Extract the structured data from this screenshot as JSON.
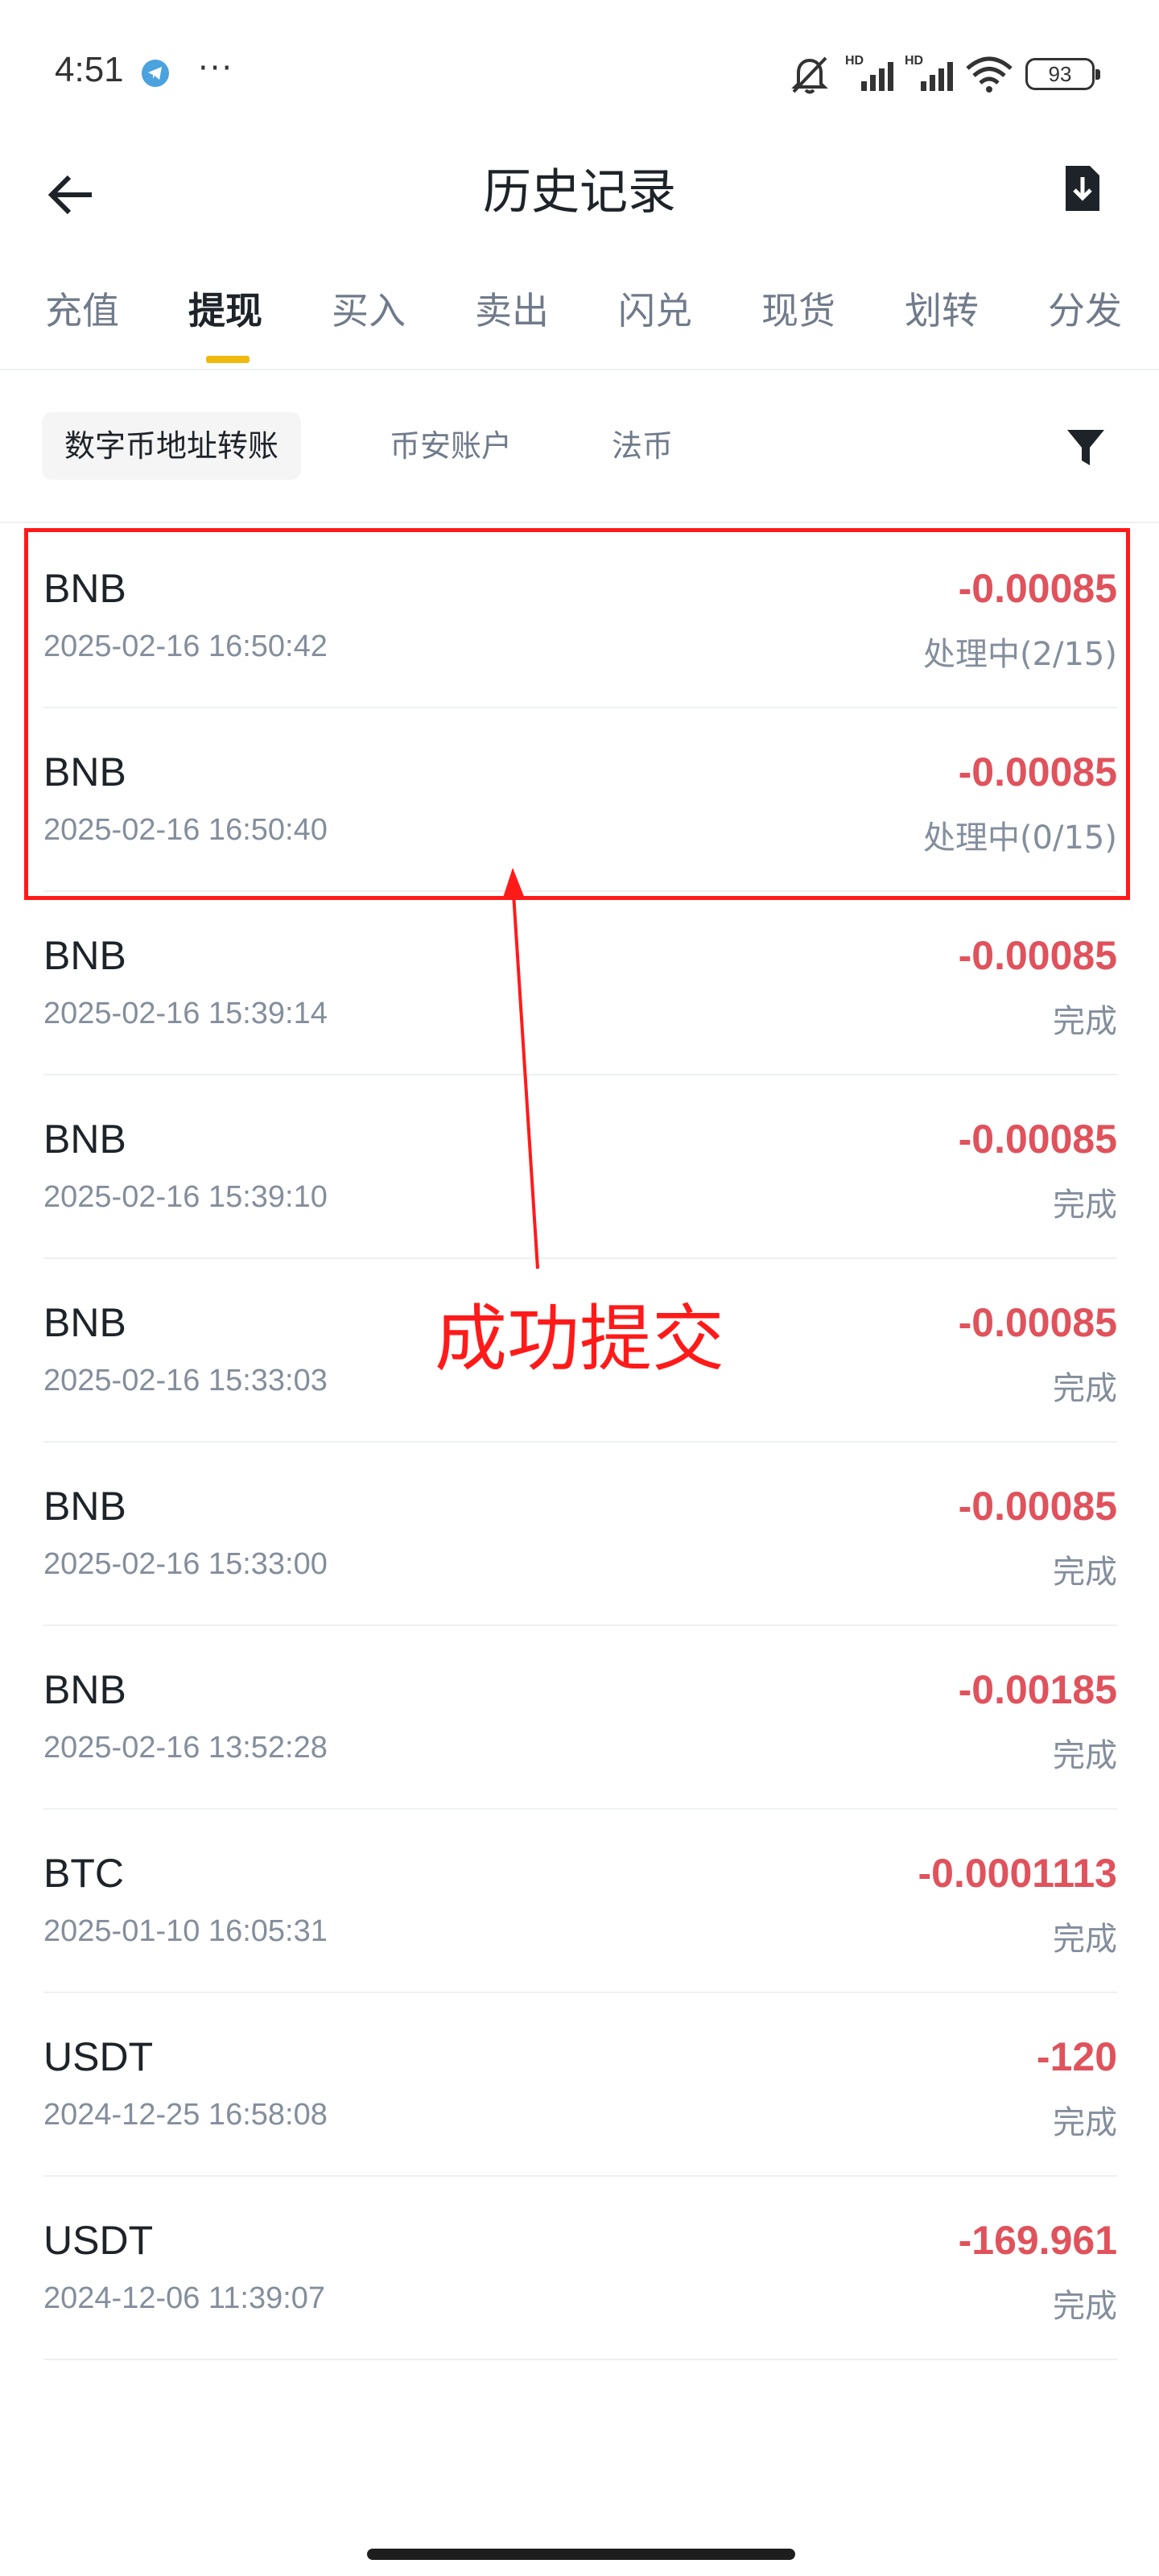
{
  "status_bar": {
    "time": "4:51",
    "more": "···",
    "hd1": "HD",
    "hd2": "HD",
    "battery": "93"
  },
  "header": {
    "title": "历史记录"
  },
  "tabs": [
    {
      "label": "充值"
    },
    {
      "label": "提现",
      "active": true
    },
    {
      "label": "买入"
    },
    {
      "label": "卖出"
    },
    {
      "label": "闪兑"
    },
    {
      "label": "现货"
    },
    {
      "label": "划转"
    },
    {
      "label": "分发"
    }
  ],
  "filters": [
    {
      "label": "数字币地址转账",
      "active": true
    },
    {
      "label": "币安账户"
    },
    {
      "label": "法币"
    }
  ],
  "records": [
    {
      "coin": "BNB",
      "time": "2025-02-16 16:50:42",
      "amount": "-0.00085",
      "status": "处理中(2/15)"
    },
    {
      "coin": "BNB",
      "time": "2025-02-16 16:50:40",
      "amount": "-0.00085",
      "status": "处理中(0/15)"
    },
    {
      "coin": "BNB",
      "time": "2025-02-16 15:39:14",
      "amount": "-0.00085",
      "status": "完成"
    },
    {
      "coin": "BNB",
      "time": "2025-02-16 15:39:10",
      "amount": "-0.00085",
      "status": "完成"
    },
    {
      "coin": "BNB",
      "time": "2025-02-16 15:33:03",
      "amount": "-0.00085",
      "status": "完成"
    },
    {
      "coin": "BNB",
      "time": "2025-02-16 15:33:00",
      "amount": "-0.00085",
      "status": "完成"
    },
    {
      "coin": "BNB",
      "time": "2025-02-16 13:52:28",
      "amount": "-0.00185",
      "status": "完成"
    },
    {
      "coin": "BTC",
      "time": "2025-01-10 16:05:31",
      "amount": "-0.0001113",
      "status": "完成"
    },
    {
      "coin": "USDT",
      "time": "2024-12-25 16:58:08",
      "amount": "-120",
      "status": "完成"
    },
    {
      "coin": "USDT",
      "time": "2024-12-06 11:39:07",
      "amount": "-169.961",
      "status": "完成"
    }
  ],
  "annotation": {
    "text": "成功提交"
  },
  "colors": {
    "accent": "#f0b90b",
    "negative": "#e0525c",
    "annotation": "#ff1a1a"
  }
}
